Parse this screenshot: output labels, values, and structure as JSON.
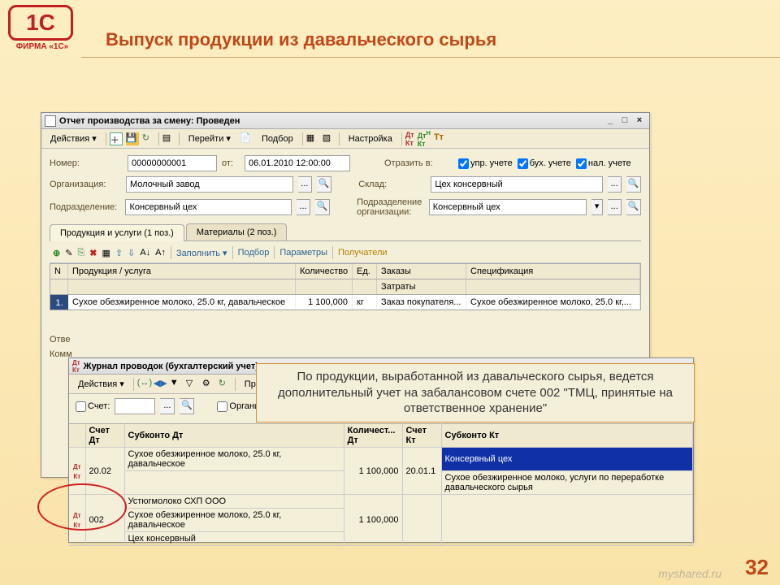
{
  "logo": {
    "mark": "1C",
    "sub": "ФИРМА «1С»"
  },
  "slide_title": "Выпуск продукции из давальческого сырья",
  "page_num": "32",
  "watermark": "myshared.ru",
  "win1": {
    "title": "Отчет производства за смену: Проведен",
    "toolbar": {
      "actions": "Действия ▾",
      "goto": "Перейти ▾",
      "podbor": "Подбор",
      "setup": "Настройка"
    },
    "fields": {
      "num_lbl": "Номер:",
      "num": "00000000001",
      "date_lbl": "от:",
      "date": "06.01.2010 12:00:00",
      "reflect_lbl": "Отразить в:",
      "chk1": "упр. учете",
      "chk2": "бух. учете",
      "chk3": "нал. учете",
      "org_lbl": "Организация:",
      "org": "Молочный завод",
      "sklad_lbl": "Склад:",
      "sklad": "Цех консервный",
      "podr_lbl": "Подразделение:",
      "podr": "Консервный цех",
      "podrorg_lbl": "Подразделение организации:",
      "podrorg": "Консервный цех"
    },
    "tabs": {
      "t1": "Продукция и услуги (1 поз.)",
      "t2": "Материалы (2 поз.)"
    },
    "subbar": {
      "fill": "Заполнить ▾",
      "podbor": "Подбор",
      "params": "Параметры",
      "recip": "Получатели"
    },
    "grid": {
      "hn": "N",
      "hprod": "Продукция / услуга",
      "hqty": "Количество",
      "hed": "Ед.",
      "hord": "Заказы",
      "hspec": "Спецификация",
      "hcost": "Затраты",
      "row": {
        "n": "1.",
        "prod": "Сухое обезжиренное молоко, 25.0 кг, давальческое",
        "qty": "1 100,000",
        "ed": "кг",
        "ord": "Заказ покупателя...",
        "spec": "Сухое обезжиренное молоко, 25.0 кг,..."
      }
    },
    "otv_lbl": "Отве",
    "komm_lbl": "Комм"
  },
  "win2": {
    "title": "Журнал проводок (бухгалтерский учет)",
    "toolbar": {
      "actions": "Действия ▾",
      "check": "Провер"
    },
    "filter": {
      "acc_lbl": "Счет:",
      "org_lbl": "Организация:"
    },
    "head": {
      "c1": "Счет Дт",
      "c2": "Субконто Дт",
      "c3": "Количест... Дт",
      "c4": "Счет Кт",
      "c5": "Субконто Кт"
    },
    "rows": [
      {
        "acc": "20.02",
        "sub": "Сухое обезжиренное молоко, 25.0 кг, давальческое",
        "qty": "1 100,000",
        "acc2": "20.01.1",
        "sub2a": "Консервный цех",
        "sub2b": "Сухое обезжиренное молоко, услуги по переработке давальческого сырья"
      },
      {
        "acc": "002",
        "sub_a": "Устюгмолоко СХП ООО",
        "sub_b": "Сухое обезжиренное молоко, 25.0 кг, давальческое",
        "sub_c": "Цех консервный",
        "qty": "1 100,000",
        "acc2": "",
        "sub2": ""
      }
    ]
  },
  "callout": "По продукции, выработанной из давальческого сырья, ведется дополнительный учет на забалансовом счете 002 \"ТМЦ, принятые на ответственное хранение\""
}
